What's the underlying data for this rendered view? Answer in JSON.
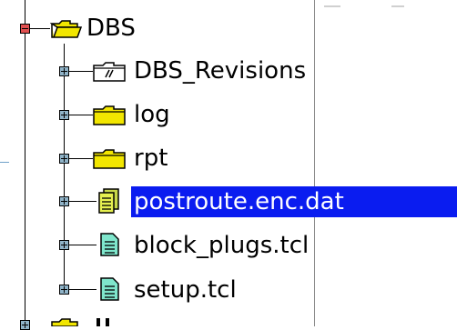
{
  "tree": {
    "root": {
      "label": "DBS",
      "expanded": true
    },
    "children": [
      {
        "label": "DBS_Revisions",
        "icon": "folder-link-icon",
        "selected": false
      },
      {
        "label": "log",
        "icon": "folder-icon",
        "selected": false
      },
      {
        "label": "rpt",
        "icon": "folder-icon",
        "selected": false
      },
      {
        "label": "postroute.enc.dat",
        "icon": "data-file-icon",
        "selected": true
      },
      {
        "label": "block_plugs.tcl",
        "icon": "script-file-icon",
        "selected": false
      },
      {
        "label": "setup.tcl",
        "icon": "script-file-icon",
        "selected": false
      }
    ]
  },
  "colors": {
    "selection": "#0a1cf0",
    "folder": "#f2e600",
    "root_expander": "#e05050",
    "expander": "#8fb3c8"
  }
}
